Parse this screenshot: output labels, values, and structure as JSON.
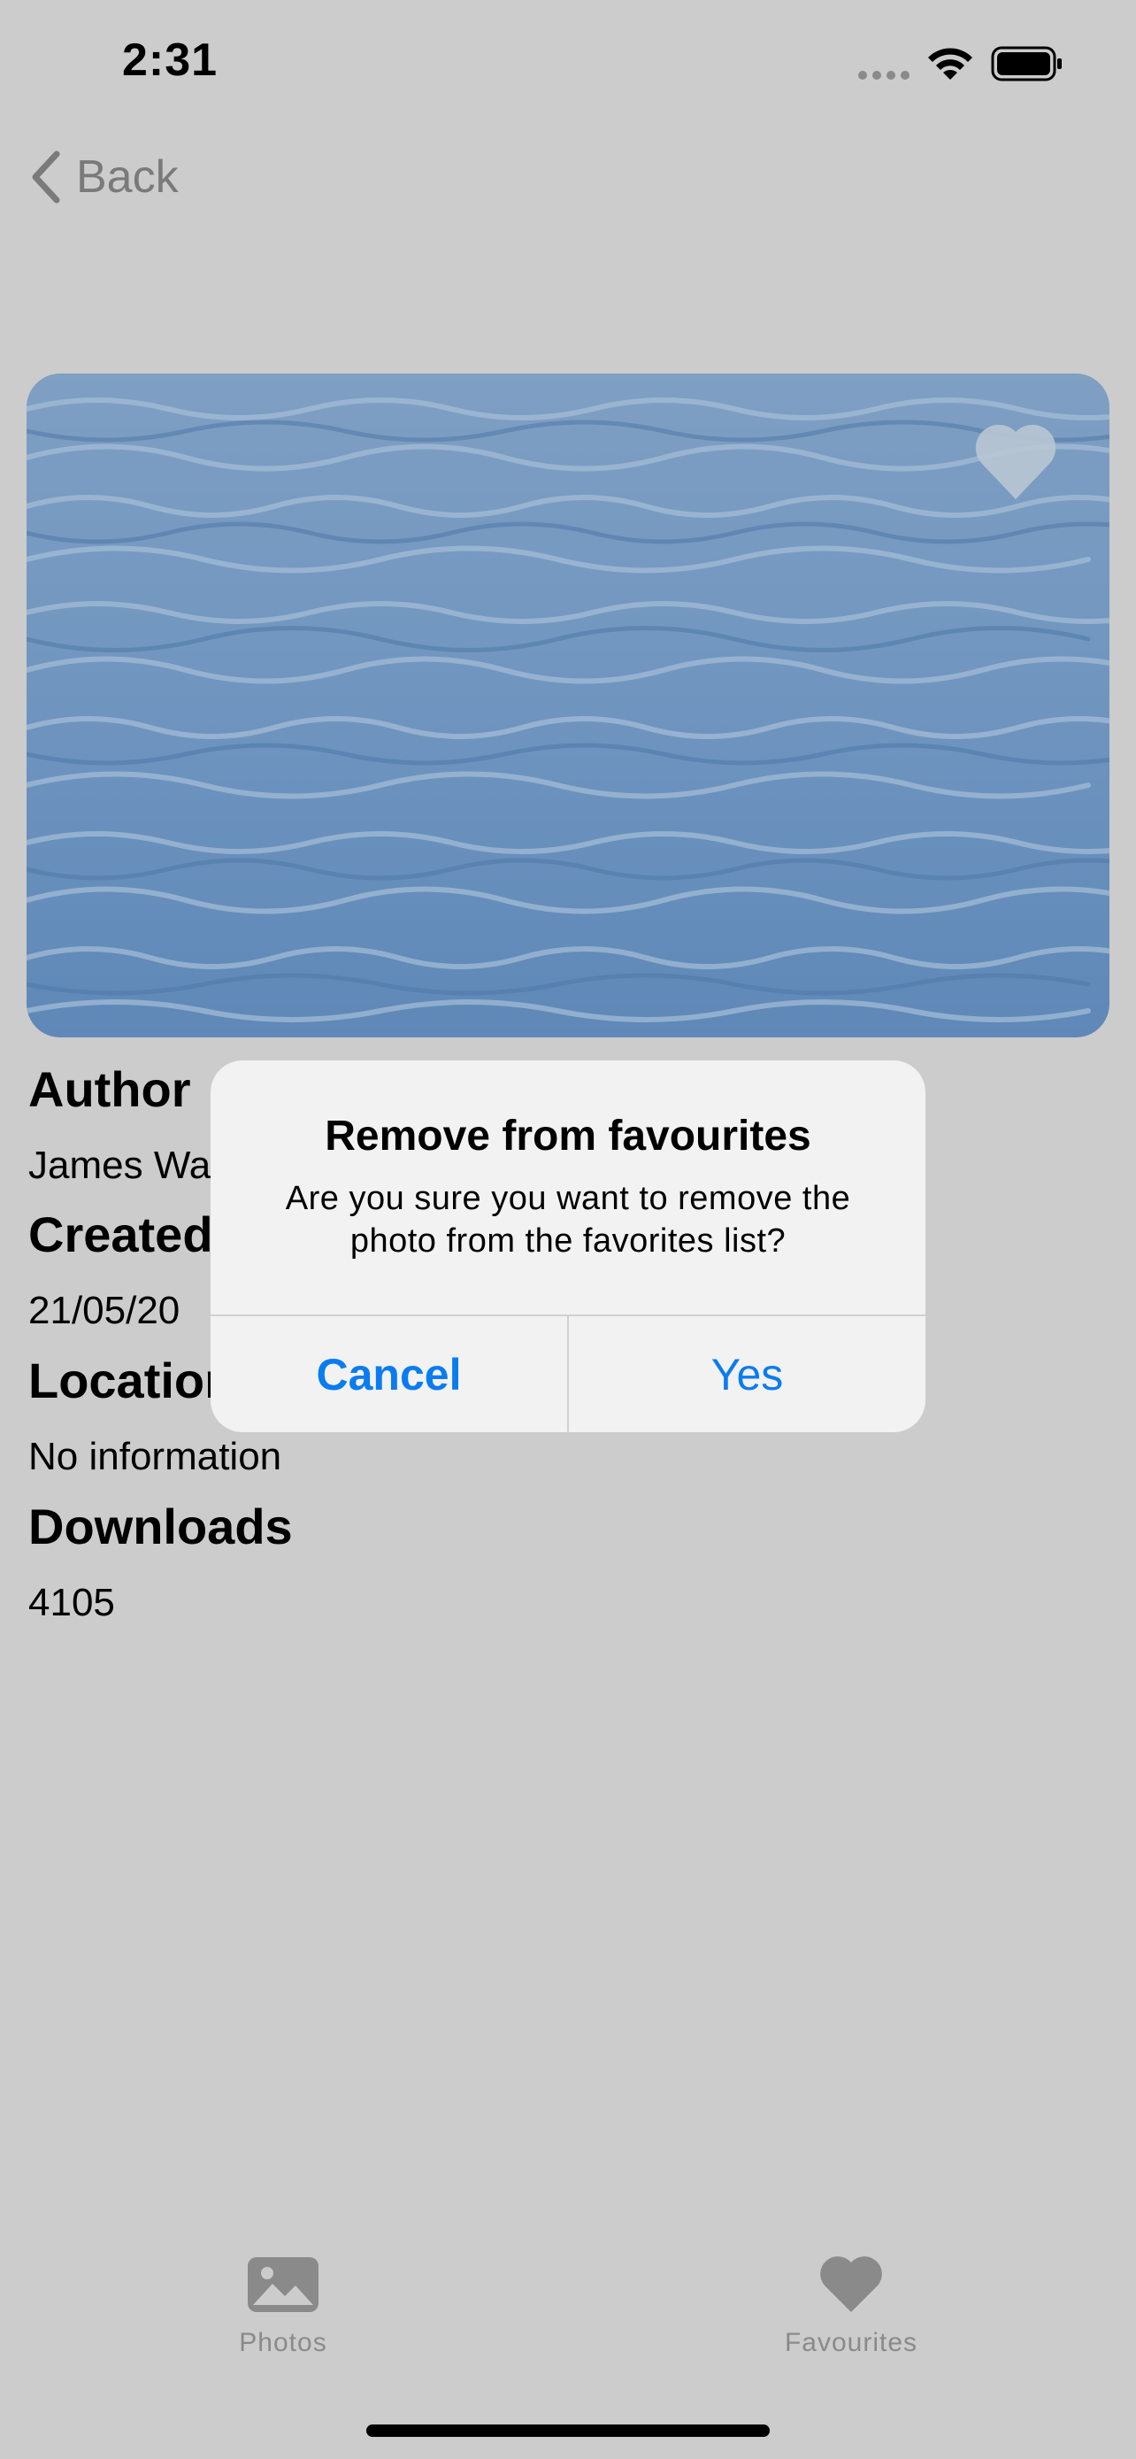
{
  "status_bar": {
    "time": "2:31"
  },
  "nav": {
    "back_label": "Back"
  },
  "details": {
    "author_label": "Author",
    "author_value": "James Wa",
    "created_label": "Created",
    "created_value": "21/05/20",
    "location_label": "Location",
    "location_value": "No information",
    "downloads_label": "Downloads",
    "downloads_value": "4105"
  },
  "alert": {
    "title": "Remove from favourites",
    "message": "Are you sure you want to remove the photo from the favorites list?",
    "cancel_label": "Cancel",
    "confirm_label": "Yes"
  },
  "tab_bar": {
    "items": [
      {
        "label": "Photos",
        "icon": "photo-icon"
      },
      {
        "label": "Favourites",
        "icon": "heart-icon"
      }
    ]
  },
  "colors": {
    "accent": "#0a7cf0",
    "dim_background": "#cccccc",
    "alert_background": "#f2f2f2"
  }
}
